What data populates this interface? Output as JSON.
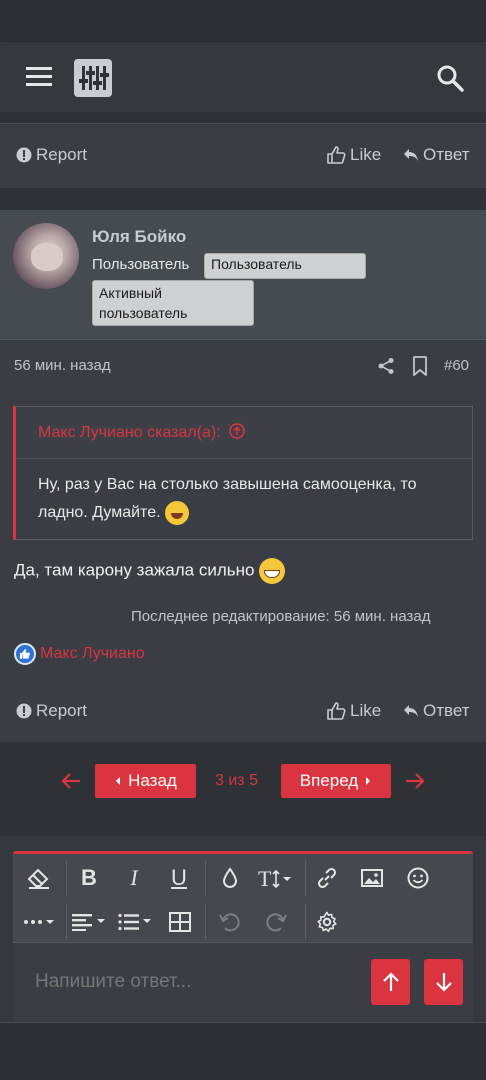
{
  "colors": {
    "accent": "#d9343f",
    "background": "#2e3136",
    "card": "#3a3e44"
  },
  "header": {
    "menu_icon": "hamburger-icon",
    "logo_icon": "sliders-logo-icon",
    "search_icon": "search-icon"
  },
  "actions_top": {
    "report": "Report",
    "like": "Like",
    "reply": "Ответ"
  },
  "post": {
    "author": "Юля Бойко",
    "user_title": "Пользователь",
    "badges": [
      "Пользователь",
      "Активный пользователь"
    ],
    "time": "56 мин. назад",
    "number": "#60",
    "quote": {
      "author": "Макс Лучиано сказал(а):",
      "text": "Ну, раз у Вас на столько завышена самооценка, то ладно. Думайте."
    },
    "text": "Да, там карону зажала сильно",
    "edited": "Последнее редактирование: 56 мин. назад",
    "reaction_user": "Макс Лучиано"
  },
  "actions_bottom": {
    "report": "Report",
    "like": "Like",
    "reply": "Ответ"
  },
  "pagination": {
    "prev": "Назад",
    "info": "3 из 5",
    "next": "Вперед"
  },
  "editor": {
    "placeholder": "Напишите ответ...",
    "toolbar_row1": [
      "eraser-icon",
      "bold-icon",
      "italic-icon",
      "underline-icon",
      "color-icon",
      "text-size-icon",
      "link-icon",
      "image-icon",
      "smiley-icon"
    ],
    "toolbar_row2": [
      "more-icon",
      "align-icon",
      "list-icon",
      "table-icon",
      "undo-icon",
      "redo-icon",
      "settings-icon"
    ]
  }
}
